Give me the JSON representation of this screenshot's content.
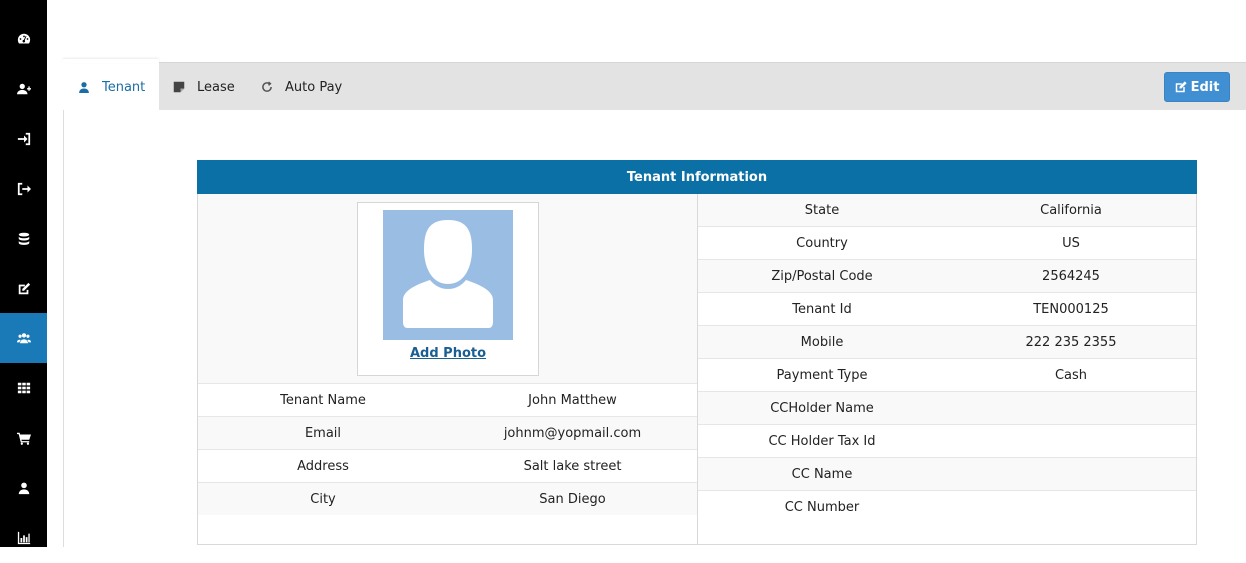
{
  "sidebar": {
    "items": [
      {
        "icon": "dashboard-icon"
      },
      {
        "icon": "add-user-icon"
      },
      {
        "icon": "sign-in-icon"
      },
      {
        "icon": "sign-out-icon"
      },
      {
        "icon": "database-icon"
      },
      {
        "icon": "edit-icon"
      },
      {
        "icon": "users-icon",
        "active": true
      },
      {
        "icon": "grid-icon"
      },
      {
        "icon": "cart-icon"
      },
      {
        "icon": "user-icon"
      },
      {
        "icon": "bar-chart-icon"
      }
    ],
    "active_color": "#1a7ab7"
  },
  "tabs": {
    "tenant": "Tenant",
    "lease": "Lease",
    "autopay": "Auto Pay"
  },
  "edit_label": "Edit",
  "panel": {
    "title": "Tenant Information",
    "add_photo": "Add Photo",
    "left_rows": [
      {
        "label": "Tenant Name",
        "value": "John Matthew"
      },
      {
        "label": "Email",
        "value": "johnm@yopmail.com"
      },
      {
        "label": "Address",
        "value": "Salt lake street"
      },
      {
        "label": "City",
        "value": "San Diego"
      }
    ],
    "right_rows": [
      {
        "label": "State",
        "value": "California"
      },
      {
        "label": "Country",
        "value": "US"
      },
      {
        "label": "Zip/Postal Code",
        "value": "2564245"
      },
      {
        "label": "Tenant Id",
        "value": "TEN000125"
      },
      {
        "label": "Mobile",
        "value": "222 235 2355"
      },
      {
        "label": "Payment Type",
        "value": "Cash"
      },
      {
        "label": "CCHolder Name",
        "value": ""
      },
      {
        "label": "CC Holder Tax Id",
        "value": ""
      },
      {
        "label": "CC Name",
        "value": ""
      },
      {
        "label": "CC Number",
        "value": ""
      }
    ]
  },
  "colors": {
    "header_bg": "#0a70a6",
    "edit_button": "#3f8fd2",
    "avatar_bg": "#9abee3"
  }
}
